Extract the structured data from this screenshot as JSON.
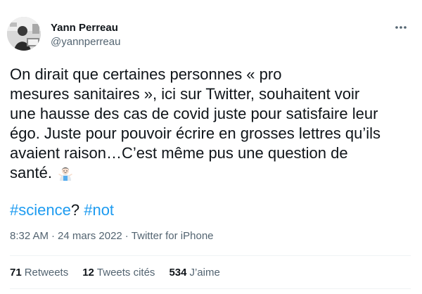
{
  "author": {
    "name": "Yann Perreau",
    "handle": "@yannperreau",
    "avatar_icon": "profile-photo"
  },
  "more_icon": "more-dots-icon",
  "tweet": {
    "lines": [
      "On dirait que certaines personnes  « pro",
      "mesures sanitaires », ici sur Twitter, souhaitent voir",
      "une hausse des cas de covid juste pour satisfaire leur",
      "égo. Juste pour pouvoir écrire en grosses lettres qu’ils",
      "avaient raison…C’est même pus une question de",
      "santé."
    ],
    "emoji": "man-shrugging-emoji",
    "hashtags": {
      "first": "#science",
      "middle": "?",
      "second": "#not"
    }
  },
  "meta": {
    "time": "8:32 AM",
    "separator": "·",
    "date": "24 mars 2022",
    "source": "Twitter for iPhone"
  },
  "stats": [
    {
      "count": "71",
      "label": "Retweets"
    },
    {
      "count": "12",
      "label": "Tweets cités"
    },
    {
      "count": "534",
      "label": "J’aime"
    }
  ],
  "colors": {
    "text": "#0f1419",
    "secondary": "#536471",
    "link": "#1d9bf0",
    "divider": "#eff3f4"
  }
}
